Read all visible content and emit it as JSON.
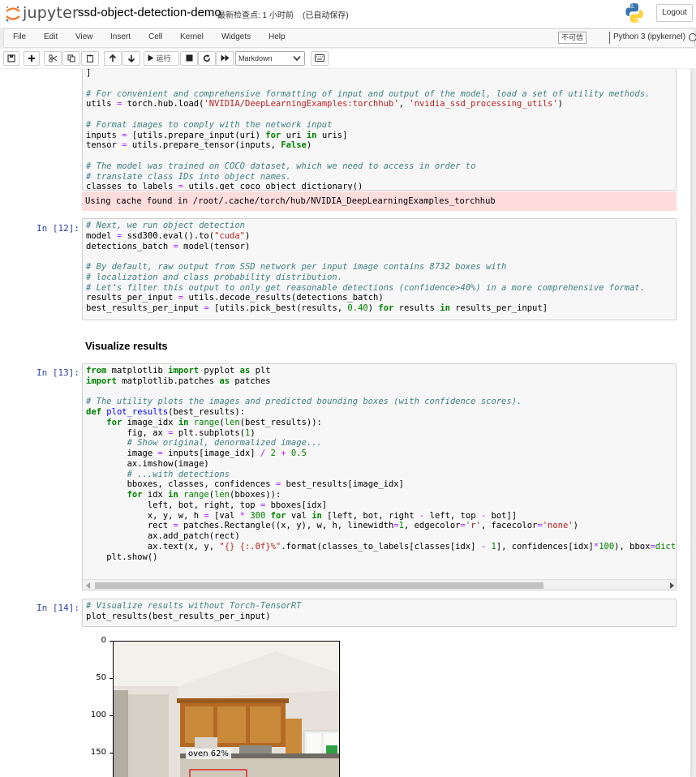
{
  "header": {
    "logo_text": "jupyter",
    "notebook_name": "ssd-object-detection-demo",
    "checkpoint": "最新检查点: 1 小时前",
    "autosave": "(已自动保存)",
    "logout_label": "Logout"
  },
  "menubar": {
    "items": [
      "File",
      "Edit",
      "View",
      "Insert",
      "Cell",
      "Kernel",
      "Widgets",
      "Help"
    ],
    "trust": "不可信",
    "kernel": "Python 3 (ipykernel)"
  },
  "toolbar": {
    "run_label": "运行",
    "cell_type": "Markdown"
  },
  "cells": {
    "cell_top": {
      "code": [
        "]",
        "",
        "# For convenient and comprehensive formatting of input and output of the model, load a set of utility methods.",
        "utils = torch.hub.load('NVIDIA/DeepLearningExamples:torchhub', 'nvidia_ssd_processing_utils')",
        "",
        "# Format images to comply with the network input",
        "inputs = [utils.prepare_input(uri) for uri in uris]",
        "tensor = utils.prepare_tensor(inputs, False)",
        "",
        "# The model was trained on COCO dataset, which we need to access in order to",
        "# translate class IDs into object names.",
        "classes_to_labels = utils.get_coco_object_dictionary()"
      ],
      "stderr": "Using cache found in /root/.cache/torch/hub/NVIDIA_DeepLearningExamples_torchhub"
    },
    "cell_12": {
      "prompt": "In [12]:",
      "code": [
        "# Next, we run object detection",
        "model = ssd300.eval().to(\"cuda\")",
        "detections_batch = model(tensor)",
        "",
        "# By default, raw output from SSD network per input image contains 8732 boxes with",
        "# localization and class probability distribution.",
        "# Let’s filter this output to only get reasonable detections (confidence>40%) in a more comprehensive format.",
        "results_per_input = utils.decode_results(detections_batch)",
        "best_results_per_input = [utils.pick_best(results, 0.40) for results in results_per_input]"
      ]
    },
    "markdown_heading": "Visualize results",
    "cell_13": {
      "prompt": "In [13]:",
      "code": [
        "from matplotlib import pyplot as plt",
        "import matplotlib.patches as patches",
        "",
        "# The utility plots the images and predicted bounding boxes (with confidence scores).",
        "def plot_results(best_results):",
        "    for image_idx in range(len(best_results)):",
        "        fig, ax = plt.subplots(1)",
        "        # Show original, denormalized image...",
        "        image = inputs[image_idx] / 2 + 0.5",
        "        ax.imshow(image)",
        "        # ...with detections",
        "        bboxes, classes, confidences = best_results[image_idx]",
        "        for idx in range(len(bboxes)):",
        "            left, bot, right, top = bboxes[idx]",
        "            x, y, w, h = [val * 300 for val in [left, bot, right - left, top - bot]]",
        "            rect = patches.Rectangle((x, y), w, h, linewidth=1, edgecolor='r', facecolor='none')",
        "            ax.add_patch(rect)",
        "            ax.text(x, y, \"{} {:.0f}%\".format(classes_to_labels[classes[idx] - 1], confidences[idx]*100), bbox=dict",
        "    plt.show()"
      ]
    },
    "cell_14": {
      "prompt": "In [14]:",
      "code": [
        "# Visualize results without Torch-TensorRT",
        "plot_results(best_results_per_input)"
      ]
    }
  },
  "output_plot": {
    "yticks": [
      "0",
      "50",
      "100",
      "150"
    ],
    "detection_label": "oven 62%"
  }
}
